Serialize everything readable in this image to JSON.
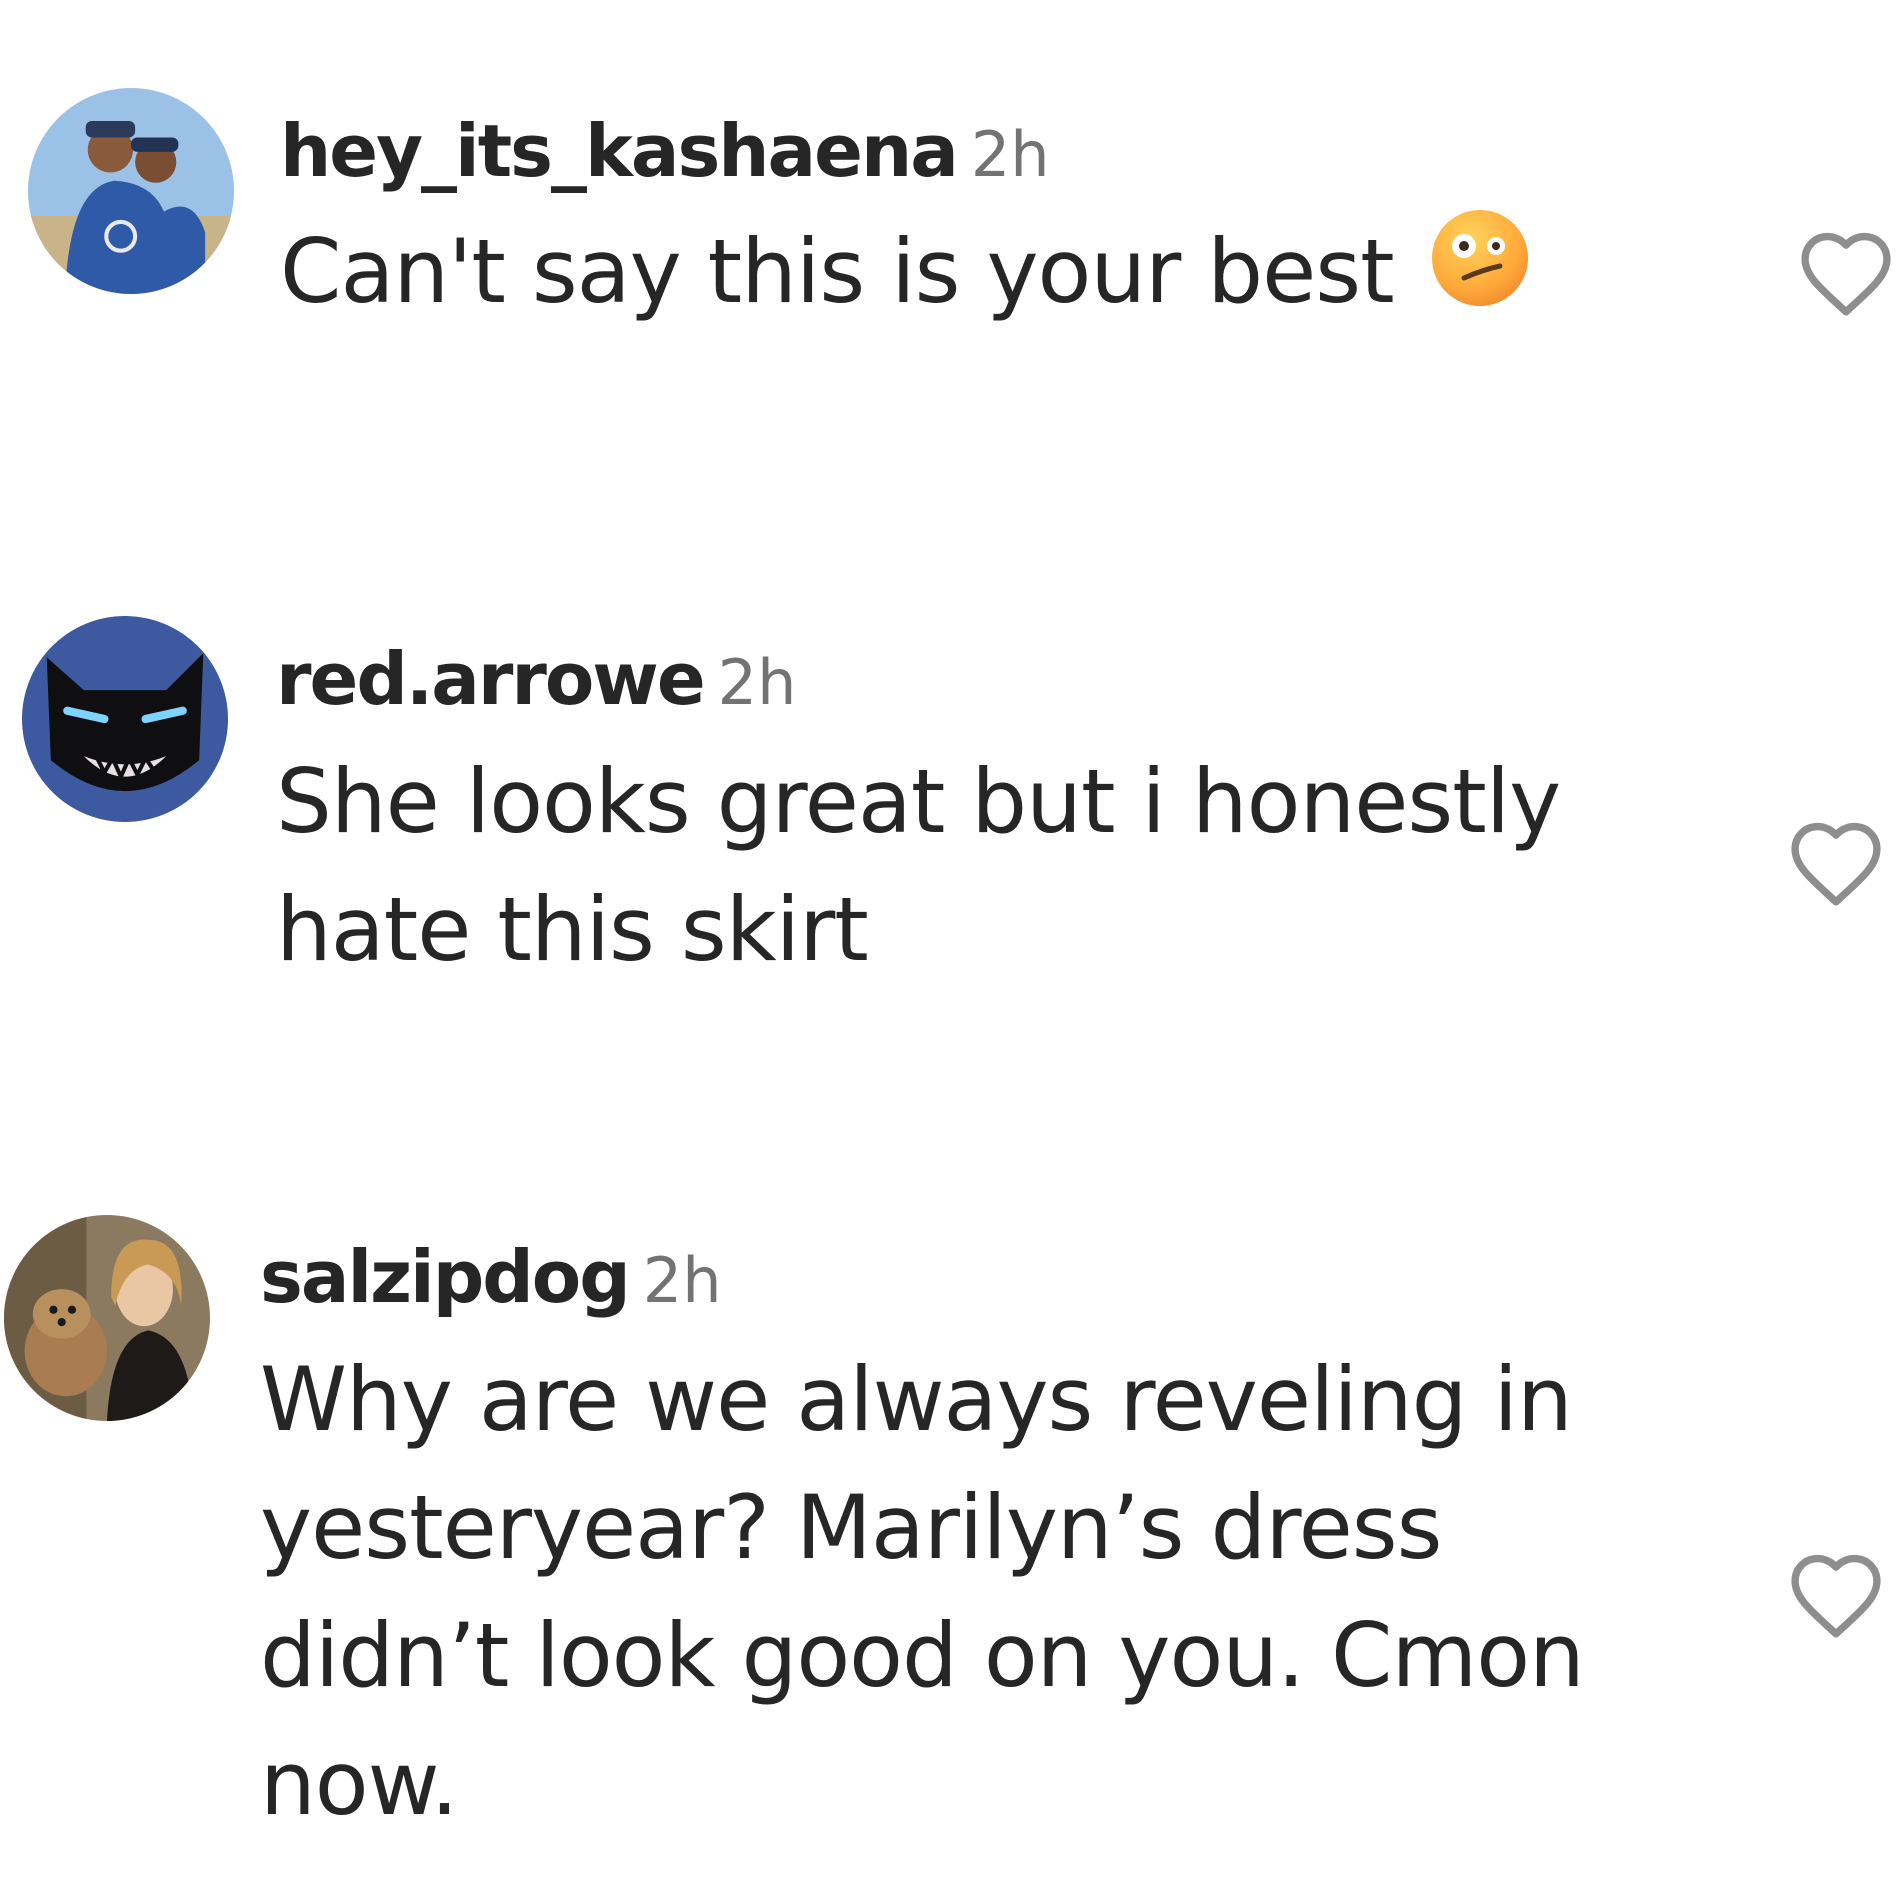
{
  "comments": [
    {
      "username": "hey_its_kashaena",
      "time": "2h",
      "text_lines": [
        "Can't say this is your best"
      ],
      "emoji": "face-with-uneven-eyes-emoji",
      "avatar": "avatar-couple-photo",
      "like_icon": "heart-outline-icon"
    },
    {
      "username": "red.arrowe",
      "time": "2h",
      "text_lines": [
        "She looks great but i honestly",
        "hate this skirt"
      ],
      "avatar": "avatar-black-cat-photo",
      "like_icon": "heart-outline-icon"
    },
    {
      "username": "salzipdog",
      "time": "2h",
      "text_lines": [
        "Why are we always reveling in",
        "yesteryear? Marilyn’s dress",
        "didn’t look good on you. Cmon",
        "now."
      ],
      "avatar": "avatar-woman-with-dog-photo",
      "like_icon": "heart-outline-icon"
    }
  ],
  "colors": {
    "text": "#262626",
    "secondary_text": "#737373",
    "icon_stroke": "#8e8e8e",
    "background": "#ffffff"
  }
}
